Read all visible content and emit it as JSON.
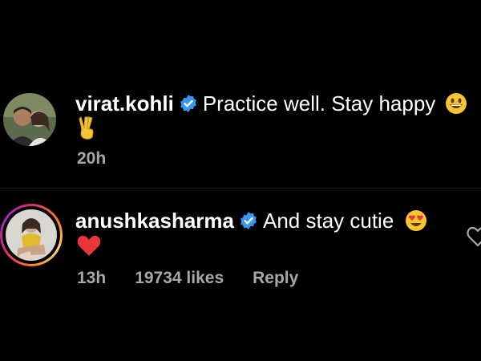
{
  "comments": [
    {
      "username": "virat.kohli",
      "verified": true,
      "text": "Practice well. Stay happy",
      "emojis": [
        "grinning-face-emoji",
        "victory-hand-emoji"
      ],
      "time": "20h"
    },
    {
      "username": "anushkasharma",
      "verified": true,
      "text": "And stay cutie",
      "emojis": [
        "heart-eyes-emoji",
        "red-heart-emoji"
      ],
      "time": "13h",
      "likes": "19734 likes",
      "reply_label": "Reply"
    }
  ],
  "colors": {
    "background": "#000000",
    "text": "#ffffff",
    "meta": "#a8a8a8",
    "verified_blue": "#3897f0"
  }
}
